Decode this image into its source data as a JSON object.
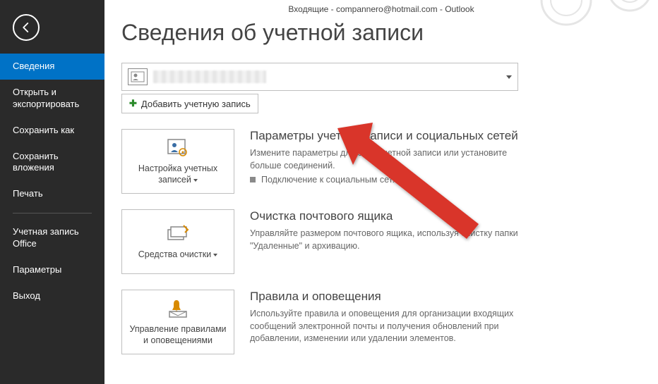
{
  "window": {
    "title": "Входящие - compannero@hotmail.com - Outlook"
  },
  "sidebar": {
    "items": [
      {
        "label": "Сведения",
        "active": true
      },
      {
        "label": "Открыть и экспортировать"
      },
      {
        "label": "Сохранить как"
      },
      {
        "label": "Сохранить вложения"
      },
      {
        "label": "Печать"
      }
    ],
    "items2": [
      {
        "label": "Учетная запись Office"
      },
      {
        "label": "Параметры"
      },
      {
        "label": "Выход"
      }
    ]
  },
  "page": {
    "title": "Сведения об учетной записи",
    "add_account": "Добавить учетную запись"
  },
  "sections": [
    {
      "tile": "Настройка учетных записей",
      "title": "Параметры учетной записи и социальных сетей",
      "desc": "Измените параметры для этой учетной записи или установите больше соединений.",
      "bullet": "Подключение к социальным сетям."
    },
    {
      "tile": "Средства очистки",
      "title": "Очистка почтового ящика",
      "desc": "Управляйте размером почтового ящика, используя очистку папки \"Удаленные\" и архивацию."
    },
    {
      "tile": "Управление правилами и оповещениями",
      "title": "Правила и оповещения",
      "desc": "Используйте правила и оповещения для организации входящих сообщений электронной почты и получения обновлений при добавлении, изменении или удалении элементов."
    }
  ]
}
